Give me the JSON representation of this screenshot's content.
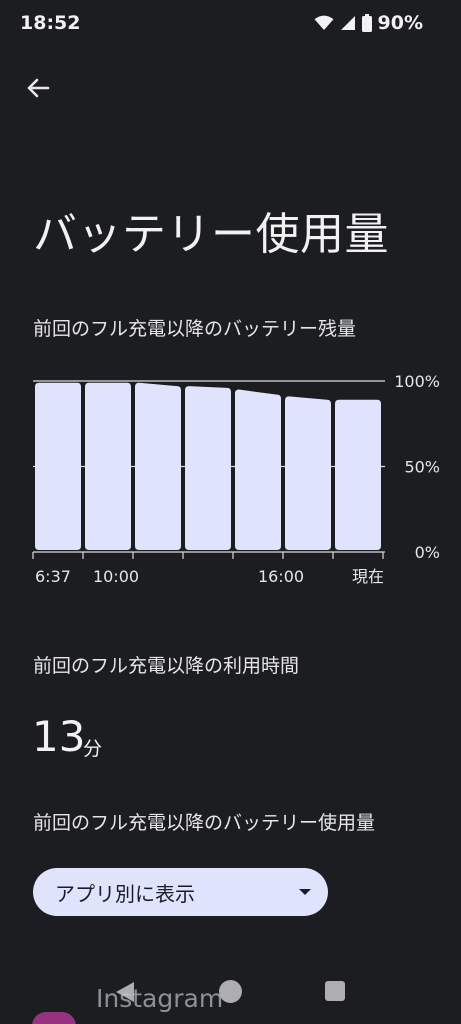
{
  "status_bar": {
    "time": "18:52",
    "battery_percent": "90%",
    "icons": [
      "wifi-icon",
      "signal-icon",
      "battery-icon"
    ]
  },
  "header": {
    "back_icon": "arrow-back-icon",
    "title": "バッテリー使用量"
  },
  "battery_level": {
    "heading": "前回のフル充電以降のバッテリー残量",
    "chart_data": {
      "type": "bar",
      "y_ticks": [
        "100%",
        "50%",
        "0%"
      ],
      "ylim": [
        0,
        100
      ],
      "x_ticks": [
        "6:37",
        "10:00",
        "16:00",
        "現在"
      ],
      "values": [
        [
          99,
          99
        ],
        [
          99,
          99
        ],
        [
          99,
          97
        ],
        [
          97,
          96
        ],
        [
          95,
          92
        ],
        [
          91,
          89
        ],
        [
          89,
          89
        ]
      ],
      "grid": true,
      "colors": {
        "bar": "#dfe3fb",
        "grid": "#dcdce0"
      }
    }
  },
  "usage_time": {
    "heading": "前回のフル充電以降の利用時間",
    "value": "13",
    "unit": "分"
  },
  "app_usage": {
    "heading": "前回のフル充電以降のバッテリー使用量",
    "dropdown_label": "アプリ別に表示"
  },
  "app_list": {
    "first_app": "Instagram"
  }
}
